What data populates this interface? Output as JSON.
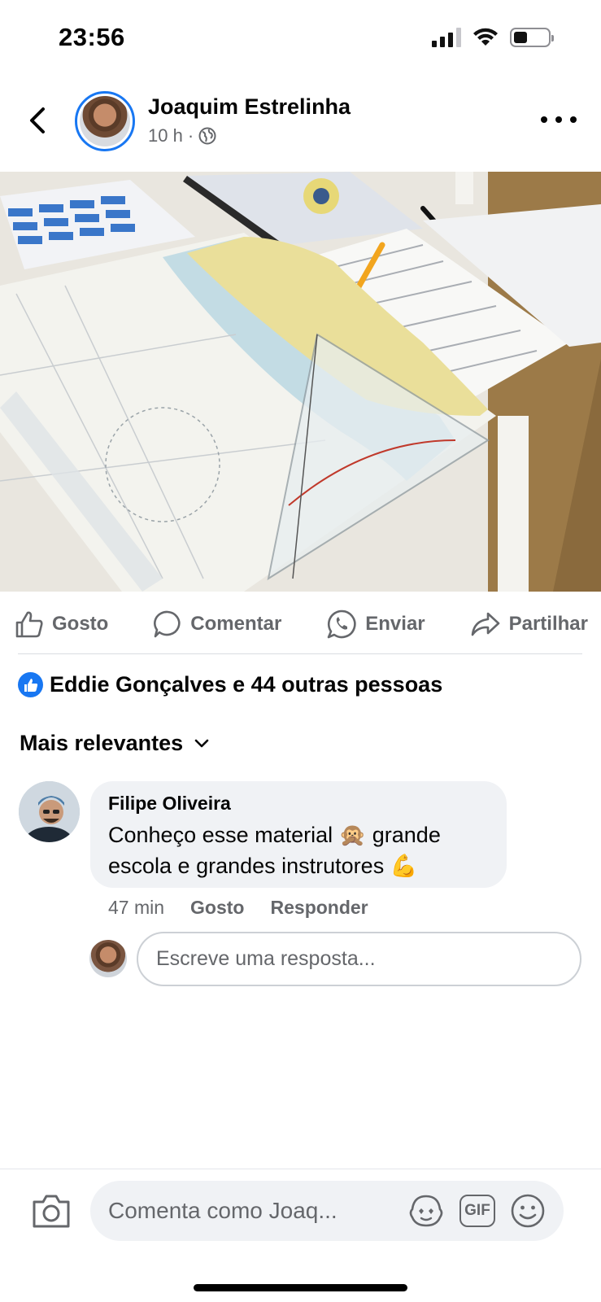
{
  "status_bar": {
    "time": "23:56",
    "icons": [
      "cellular-signal-icon",
      "wifi-icon",
      "battery-icon"
    ]
  },
  "post": {
    "author_name": "Joaquim Estrelinha",
    "time_ago": "10 h",
    "separator": "·",
    "audience_icon": "globe-icon",
    "photo_description_icons": [
      "nautical-chart",
      "navigation-protractor",
      "notebook",
      "pencil",
      "exam-sheet"
    ]
  },
  "actions": [
    {
      "label": "Gosto",
      "icon": "thumbs-up-icon"
    },
    {
      "label": "Comentar",
      "icon": "comment-bubble-icon"
    },
    {
      "label": "Enviar",
      "icon": "whatsapp-icon"
    },
    {
      "label": "Partilhar",
      "icon": "share-arrow-icon"
    }
  ],
  "reactions": {
    "text": "Eddie Gonçalves e 44 outras pessoas",
    "icon": "like-badge-icon"
  },
  "sort": {
    "label": "Mais relevantes"
  },
  "comments": [
    {
      "author": "Filipe Oliveira",
      "text": "Conheço esse material 🙊 grande escola e grandes instrutores 💪",
      "time": "47 min",
      "like_label": "Gosto",
      "reply_label": "Responder"
    }
  ],
  "reply": {
    "placeholder": "Escreve uma resposta..."
  },
  "composer": {
    "placeholder": "Comenta como Joaq...",
    "gif_label": "GIF"
  },
  "colors": {
    "accent": "#1877f2",
    "secondary_text": "#65676b",
    "bubble": "#f0f2f5"
  }
}
